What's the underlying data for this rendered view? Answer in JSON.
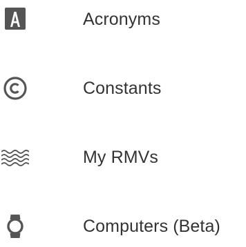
{
  "menu": {
    "items": [
      {
        "label": "Acronyms",
        "icon": "letter-a-box-icon"
      },
      {
        "label": "Constants",
        "icon": "copyright-circle-icon"
      },
      {
        "label": "My RMVs",
        "icon": "waves-icon"
      },
      {
        "label": "Computers (Beta)",
        "icon": "watch-icon"
      }
    ]
  },
  "colors": {
    "icon": "#555555",
    "text": "#333333",
    "background": "#ffffff"
  }
}
